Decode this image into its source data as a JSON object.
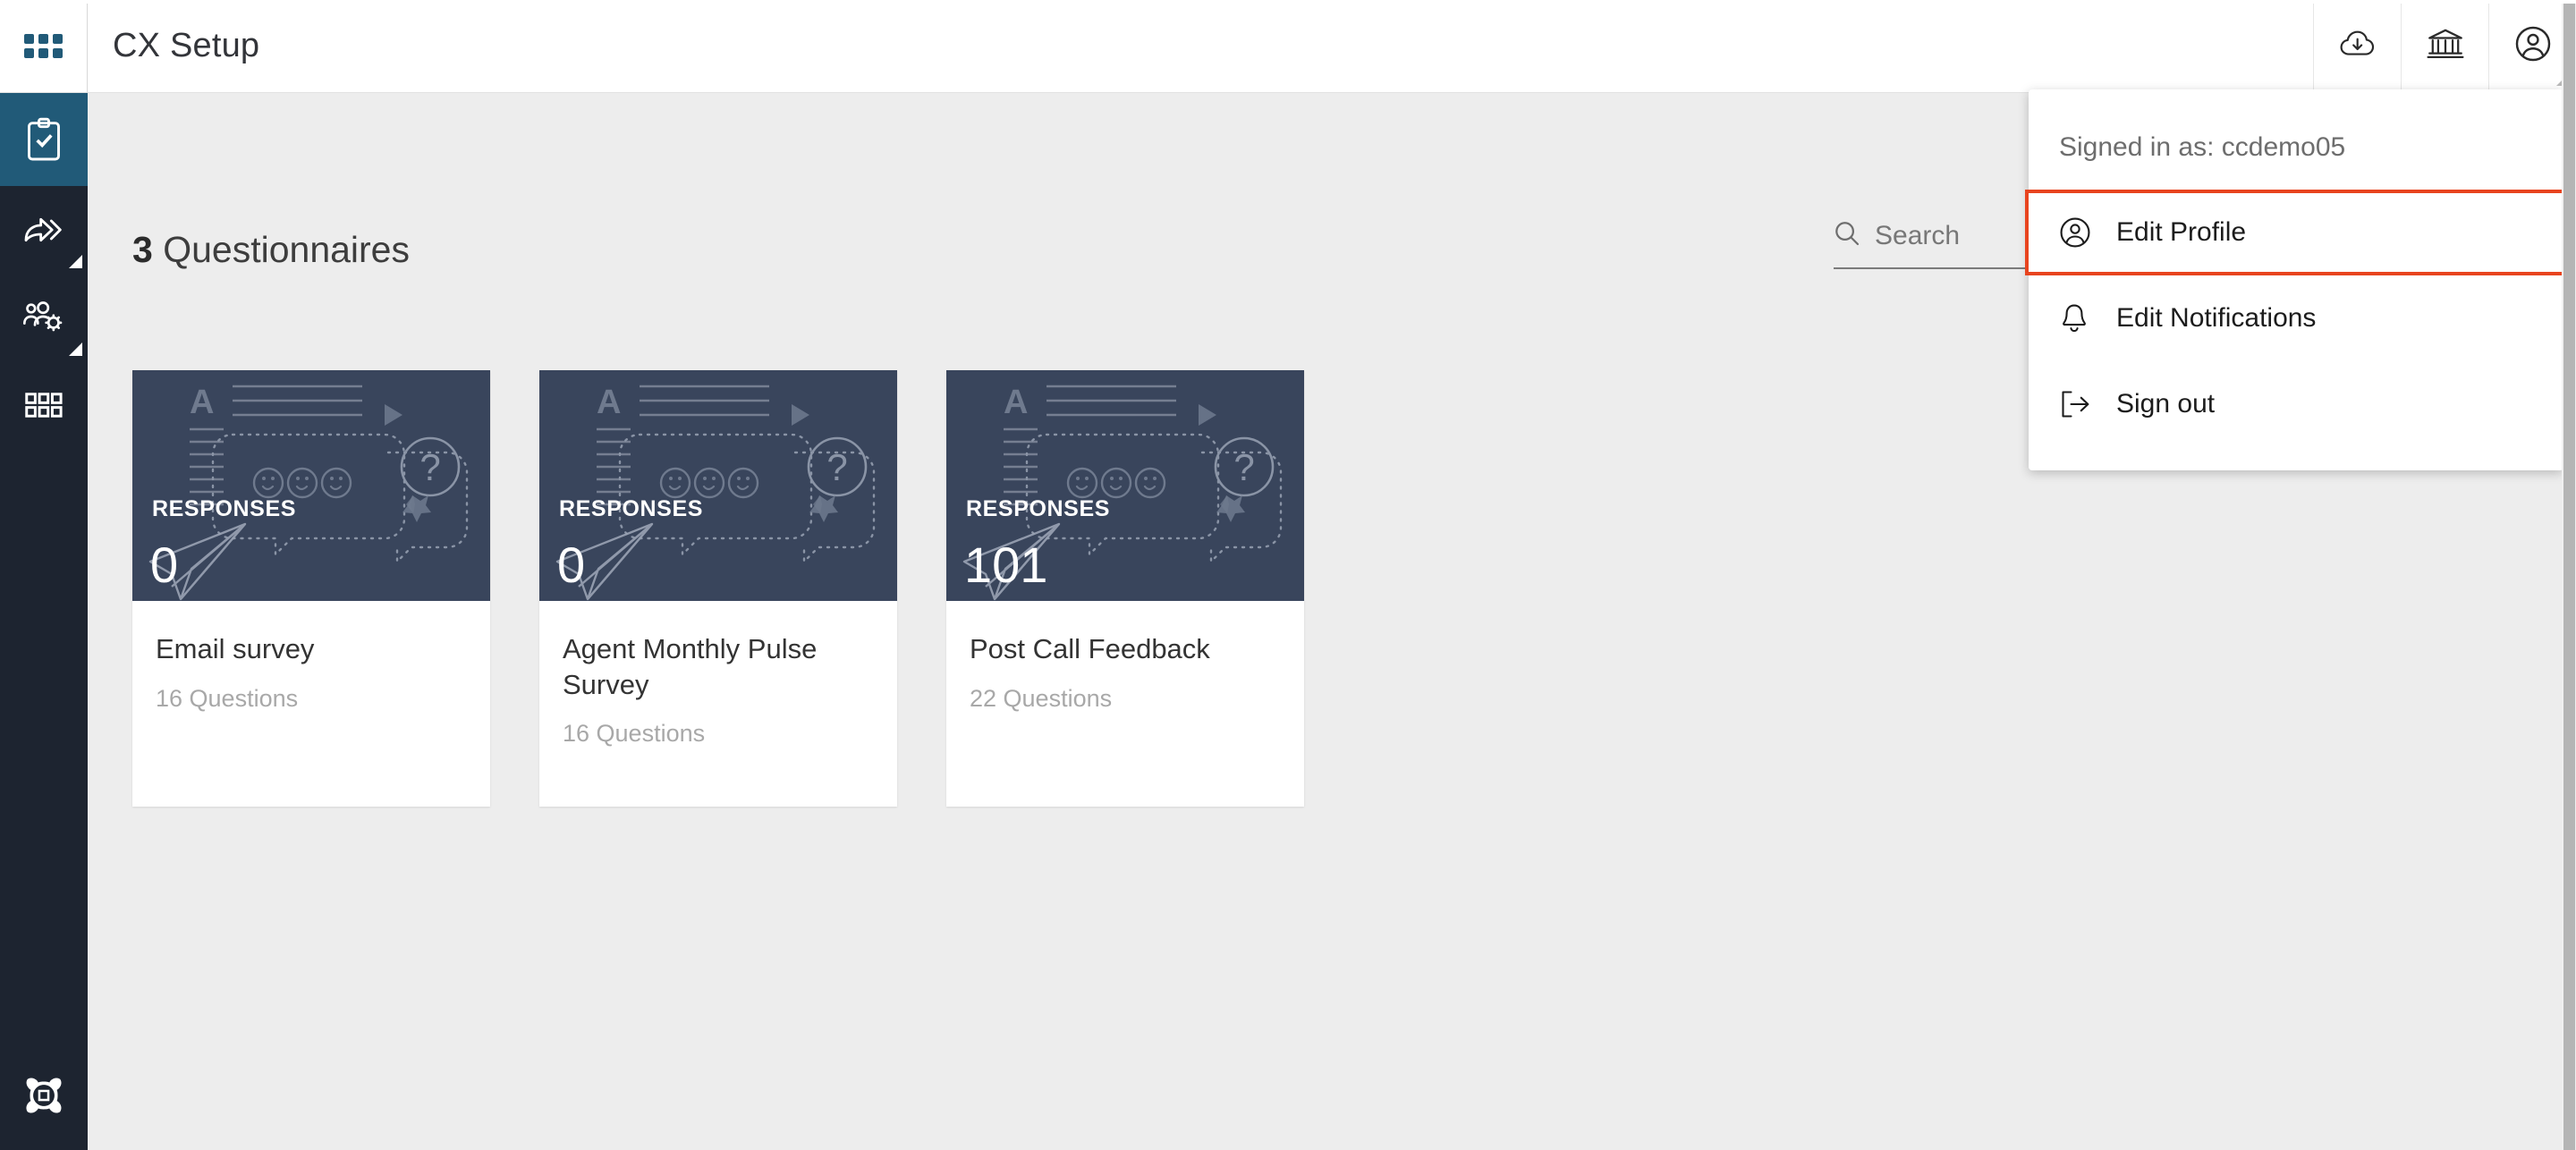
{
  "app": {
    "sidebar": {
      "app_switcher_icon": "grid-apps-icon",
      "items": [
        {
          "icon": "clipboard-check-icon",
          "name": "questionnaires",
          "active": true,
          "expandable": false
        },
        {
          "icon": "share-forward-icon",
          "name": "routing",
          "active": false,
          "expandable": true
        },
        {
          "icon": "people-gear-icon",
          "name": "admin-users",
          "active": false,
          "expandable": true
        },
        {
          "icon": "grid-modules-icon",
          "name": "modules",
          "active": false,
          "expandable": false
        }
      ],
      "logo_icon": "genesys-star-logo"
    },
    "header": {
      "title": "CX Setup",
      "actions": [
        {
          "icon": "cloud-download-icon",
          "name": "cloud-download"
        },
        {
          "icon": "bank-institution-icon",
          "name": "organization"
        },
        {
          "icon": "user-circle-icon",
          "name": "profile",
          "has_corner_indicator": true
        }
      ]
    },
    "main": {
      "count": "3",
      "title_suffix": "Questionnaires",
      "search": {
        "placeholder": "Search",
        "value": "",
        "icon": "search-icon"
      },
      "cards": [
        {
          "responses_label": "RESPONSES",
          "responses_count": "0",
          "title": "Email survey",
          "questions": "16 Questions"
        },
        {
          "responses_label": "RESPONSES",
          "responses_count": "0",
          "title": "Agent Monthly Pulse Survey",
          "questions": "16 Questions"
        },
        {
          "responses_label": "RESPONSES",
          "responses_count": "101",
          "title": "Post Call Feedback",
          "questions": "22 Questions"
        }
      ]
    },
    "dropdown": {
      "signed_in_as": "Signed in as: ccdemo05",
      "items": [
        {
          "label": "Edit Profile",
          "icon": "user-circle-icon",
          "highlighted": true
        },
        {
          "label": "Edit Notifications",
          "icon": "bell-icon",
          "highlighted": false
        },
        {
          "label": "Sign out",
          "icon": "sign-out-icon",
          "highlighted": false
        }
      ]
    },
    "colors": {
      "rail_bg": "#1d2430",
      "rail_active": "#215a78",
      "accent_teal": "#215a78",
      "card_header": "#39455c",
      "page_bg": "#ededed",
      "highlight_border": "#e8441f",
      "muted_text": "#a8a8a8"
    }
  }
}
